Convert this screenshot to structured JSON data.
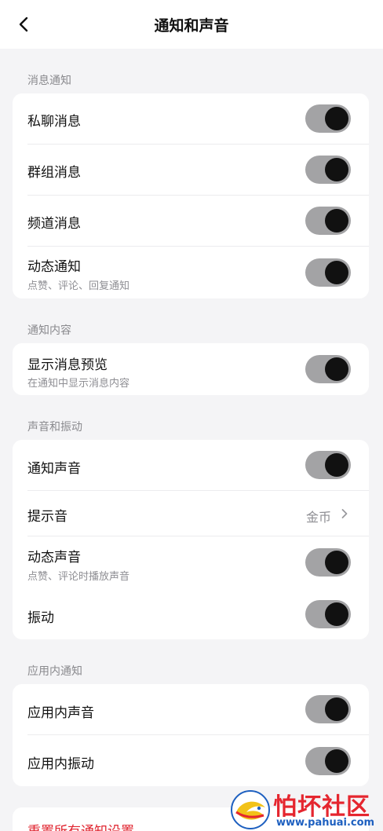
{
  "header": {
    "title": "通知和声音",
    "back_icon": "chevron-left-icon"
  },
  "sections": {
    "messages": {
      "title": "消息通知",
      "private_chat": {
        "label": "私聊消息",
        "enabled": true
      },
      "group_chat": {
        "label": "群组消息",
        "enabled": true
      },
      "channel": {
        "label": "频道消息",
        "enabled": true
      },
      "feed": {
        "label": "动态通知",
        "sub": "点赞、评论、回复通知",
        "enabled": true
      }
    },
    "content": {
      "title": "通知内容",
      "preview": {
        "label": "显示消息预览",
        "sub": "在通知中显示消息内容",
        "enabled": true
      }
    },
    "sound": {
      "title": "声音和振动",
      "notify_sound": {
        "label": "通知声音",
        "enabled": true
      },
      "tone": {
        "label": "提示音",
        "value": "金币"
      },
      "feed_sound": {
        "label": "动态声音",
        "sub": "点赞、评论时播放声音",
        "enabled": true
      },
      "vibrate": {
        "label": "振动",
        "enabled": true
      }
    },
    "in_app": {
      "title": "应用内通知",
      "in_app_sound": {
        "label": "应用内声音",
        "enabled": true
      },
      "in_app_vibrate": {
        "label": "应用内振动",
        "enabled": true
      }
    }
  },
  "reset": {
    "label": "重置所有通知设置",
    "color": "#e0242f"
  },
  "watermark": {
    "title": "怕坏社区",
    "url": "www.pahuai.com"
  },
  "colors": {
    "background": "#f4f4f6",
    "toggle_track": "#a3a3a5",
    "toggle_knob": "#111111"
  }
}
